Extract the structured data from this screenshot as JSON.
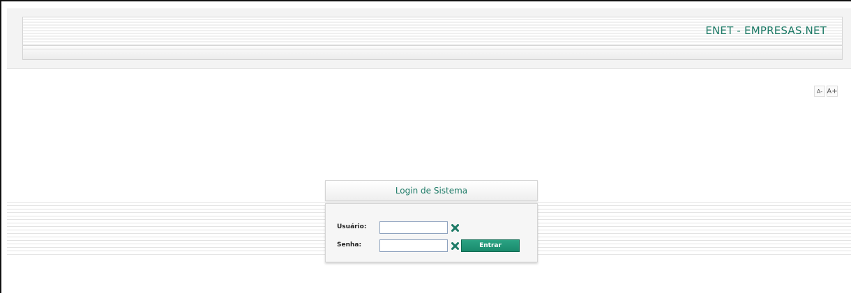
{
  "header": {
    "title": "ENET - EMPRESAS.NET"
  },
  "font_controls": {
    "decrease_label": "A-",
    "increase_label": "A+"
  },
  "login": {
    "title": "Login de Sistema",
    "username_label": "Usuário:",
    "username_value": "",
    "password_label": "Senha:",
    "password_value": "",
    "submit_label": "Entrar"
  },
  "colors": {
    "accent": "#1d7a66",
    "button": "#1a8a6c",
    "clear_icon": "#1d7a66"
  },
  "icons": {
    "clear": "x-clear-icon"
  }
}
